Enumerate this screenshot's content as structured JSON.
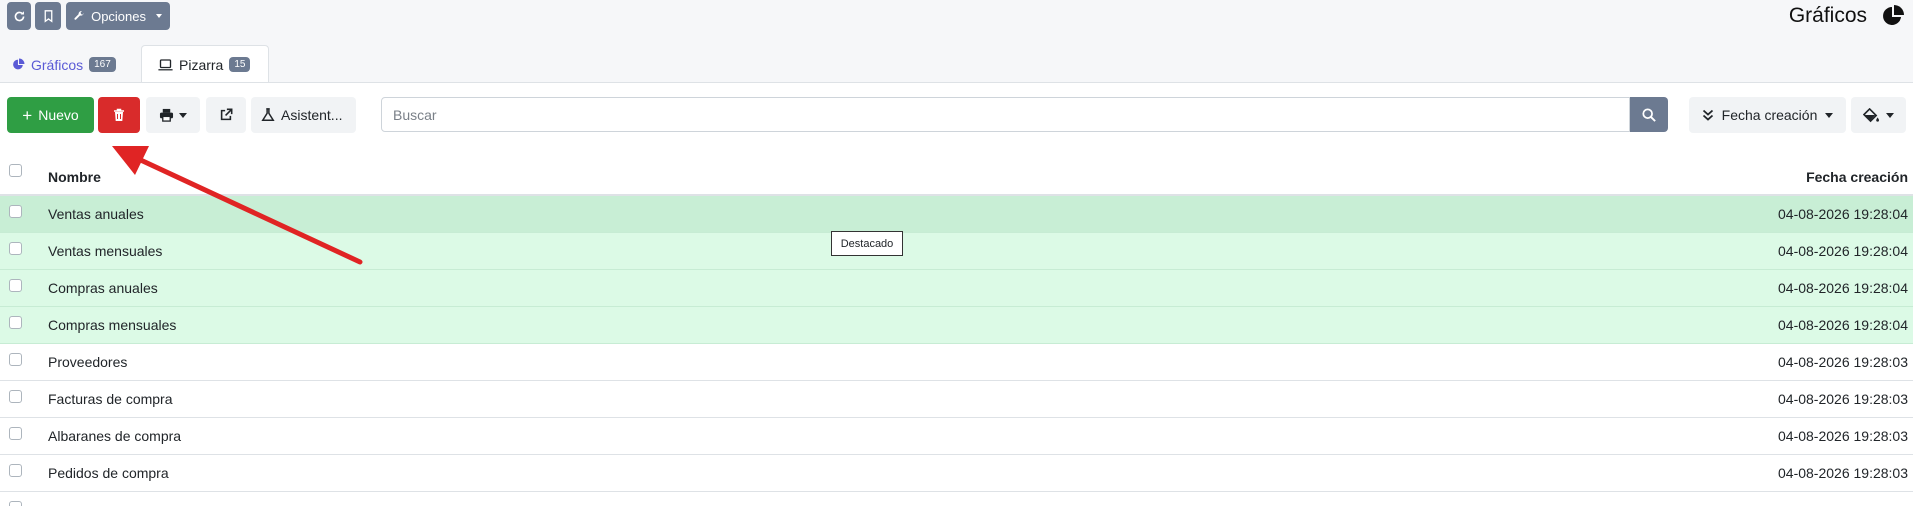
{
  "topbar": {
    "opciones_label": "Opciones",
    "page_title": "Gráficos"
  },
  "tabs": [
    {
      "label": "Gráficos",
      "count": "167"
    },
    {
      "label": "Pizarra",
      "count": "15"
    }
  ],
  "toolbar": {
    "new_label": "Nuevo",
    "assistant_label": "Asistent...",
    "sort_label": "Fecha creación"
  },
  "search": {
    "placeholder": "Buscar",
    "value": ""
  },
  "table": {
    "columns": [
      "Nombre",
      "Fecha creación"
    ],
    "rows": [
      {
        "name": "Ventas anuales",
        "date": "04-08-2026 19:28:04"
      },
      {
        "name": "Ventas mensuales",
        "date": "04-08-2026 19:28:04"
      },
      {
        "name": "Compras anuales",
        "date": "04-08-2026 19:28:04"
      },
      {
        "name": "Compras mensuales",
        "date": "04-08-2026 19:28:04"
      },
      {
        "name": "Proveedores",
        "date": "04-08-2026 19:28:03"
      },
      {
        "name": "Facturas de compra",
        "date": "04-08-2026 19:28:03"
      },
      {
        "name": "Albaranes de compra",
        "date": "04-08-2026 19:28:03"
      },
      {
        "name": "Pedidos de compra",
        "date": "04-08-2026 19:28:03"
      }
    ]
  },
  "tooltip": "Destacado",
  "colors": {
    "accent_gray": "#6c7a91",
    "new_green": "#2f9e44",
    "delete_red": "#d92b2b",
    "highlight_row": "#dcfae6",
    "annotation_arrow": "#e02424"
  }
}
